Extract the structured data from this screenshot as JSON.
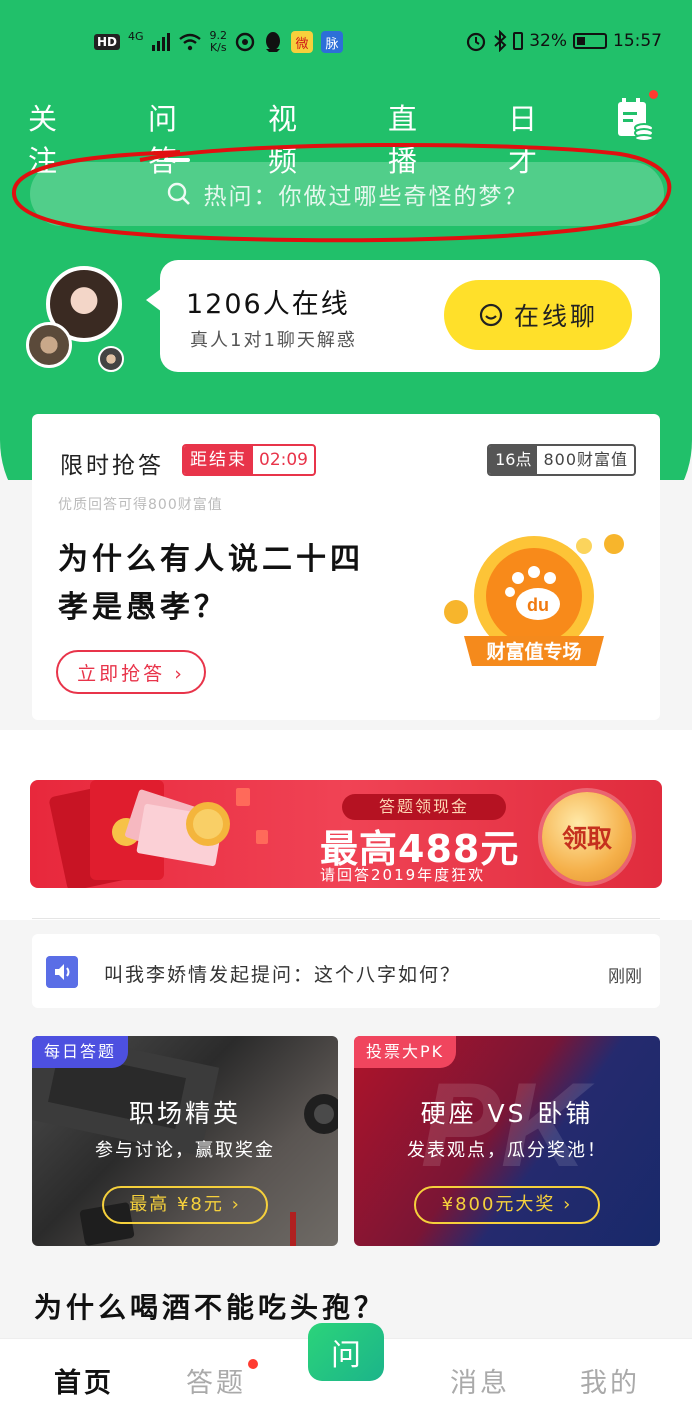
{
  "status_bar": {
    "hd": "HD",
    "net_gen": "4G",
    "speed_value": "9.2",
    "speed_unit": "K/s",
    "weibo_glyph": "微",
    "mai_glyph": "脉",
    "battery": "32%",
    "time": "15:57"
  },
  "tabs": [
    "关注",
    "问答",
    "视频",
    "直播",
    "日才"
  ],
  "search": {
    "placeholder": "热问：你做过哪些奇怪的梦？"
  },
  "online": {
    "count_text": "1206人在线",
    "sub_text": "真人1对1聊天解惑",
    "chat_button": "在线聊"
  },
  "rush": {
    "title": "限时抢答",
    "countdown_label": "距结束",
    "countdown_time": "02:09",
    "wealth_hour": "16点",
    "wealth_amount": "800财富值",
    "subtitle": "优质回答可得800财富值",
    "question": "为什么有人说二十四孝是愚孝？",
    "button": "立即抢答 ›",
    "art_label": "财富值专场",
    "art_logo": "du"
  },
  "banner": {
    "pill": "答题领现金",
    "headline": "最高488元",
    "subline": "请回答2019年度狂欢",
    "get_button": "领取"
  },
  "notice": {
    "text": "叫我李娇情发起提问：这个八字如何？",
    "time": "刚刚"
  },
  "cards": [
    {
      "tag": "每日答题",
      "title": "职场精英",
      "subtitle": "参与讨论，赢取奖金",
      "button": "最高 ¥8元 ›"
    },
    {
      "tag": "投票大PK",
      "title": "硬座 VS 卧铺",
      "subtitle": "发表观点，瓜分奖池！",
      "button": "¥800元大奖 ›",
      "watermark": "PK"
    }
  ],
  "feed_question": "为什么喝酒不能吃头孢？",
  "nav": {
    "home": "首页",
    "answer": "答题",
    "ask": "问",
    "messages": "消息",
    "mine": "我的"
  },
  "colors": {
    "brand_green": "#21c06a",
    "accent_red": "#e8344a",
    "chat_yellow": "#ffe02a",
    "annotation_red": "#e01010"
  },
  "icons": [
    "search-icon",
    "calendar-coin-icon",
    "smile-chat-icon",
    "speaker-icon",
    "alarm-icon",
    "bluetooth-icon",
    "battery-icon",
    "wifi-icon",
    "signal-icon",
    "qq-icon",
    "weibo-icon"
  ]
}
